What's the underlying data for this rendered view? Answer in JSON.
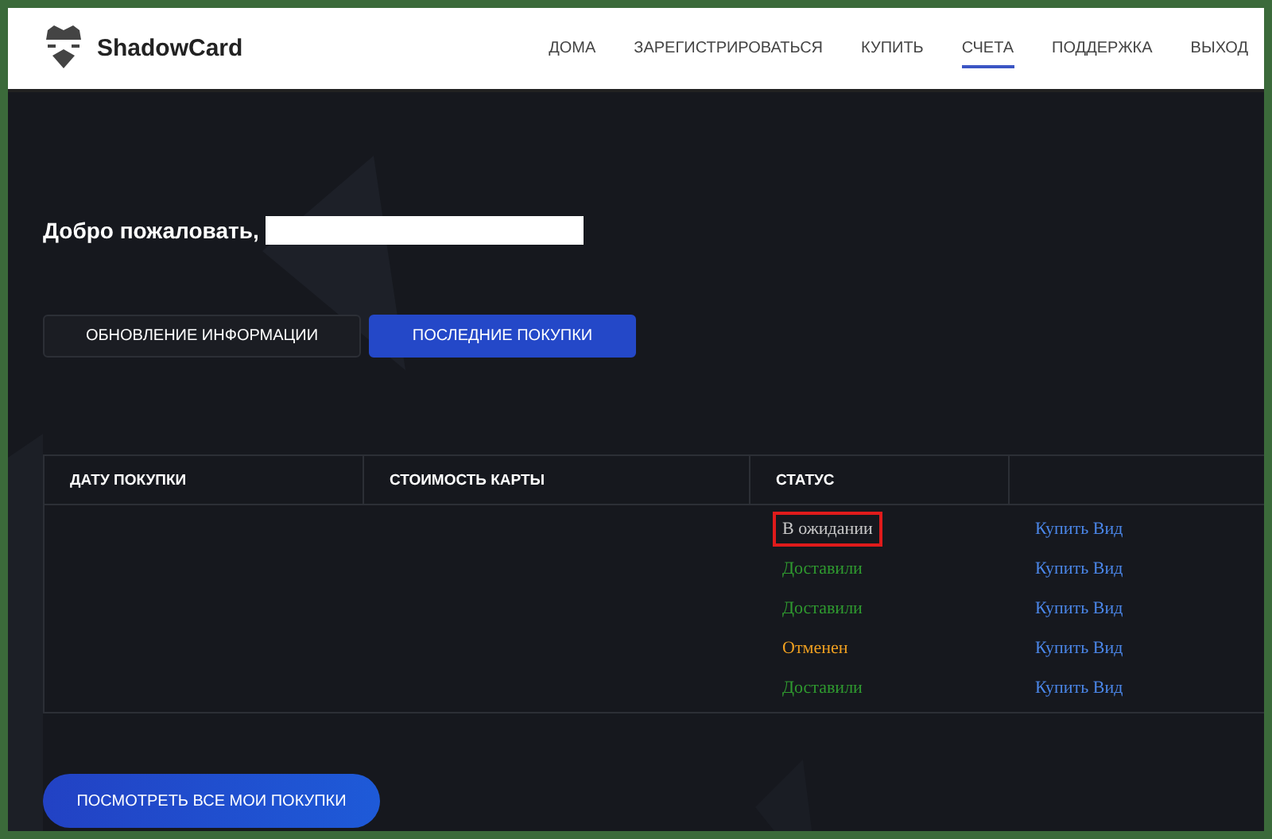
{
  "header": {
    "brand": "ShadowCard",
    "nav": [
      {
        "label": "ДОМА",
        "selected": false
      },
      {
        "label": "ЗАРЕГИСТРИРОВАТЬСЯ",
        "selected": false
      },
      {
        "label": "КУПИТЬ",
        "selected": false
      },
      {
        "label": "СЧЕТА",
        "selected": true
      },
      {
        "label": "ПОДДЕРЖКА",
        "selected": false
      },
      {
        "label": "ВЫХОД",
        "selected": false
      }
    ]
  },
  "welcome": {
    "text": "Добро пожаловать,",
    "name_redacted": true
  },
  "tabs": [
    {
      "label": "ОБНОВЛЕНИЕ ИНФОРМАЦИИ",
      "selected": false
    },
    {
      "label": "ПОСЛЕДНИЕ ПОКУПКИ",
      "selected": true
    }
  ],
  "table": {
    "columns": [
      "ДАТУ ПОКУПКИ",
      "СТОИМОСТЬ КАРТЫ",
      "СТАТУС"
    ],
    "rows": [
      {
        "status": "В ожидании",
        "kind": "pending",
        "highlighted": true,
        "action": "Купить Вид"
      },
      {
        "status": "Доставили",
        "kind": "delivered",
        "highlighted": false,
        "action": "Купить Вид"
      },
      {
        "status": "Доставили",
        "kind": "delivered",
        "highlighted": false,
        "action": "Купить Вид"
      },
      {
        "status": "Отменен",
        "kind": "cancelled",
        "highlighted": false,
        "action": "Купить Вид"
      },
      {
        "status": "Доставили",
        "kind": "delivered",
        "highlighted": false,
        "action": "Купить Вид"
      }
    ]
  },
  "view_all_button": "ПОСМОТРЕТЬ ВСЕ МОИ ПОКУПКИ"
}
